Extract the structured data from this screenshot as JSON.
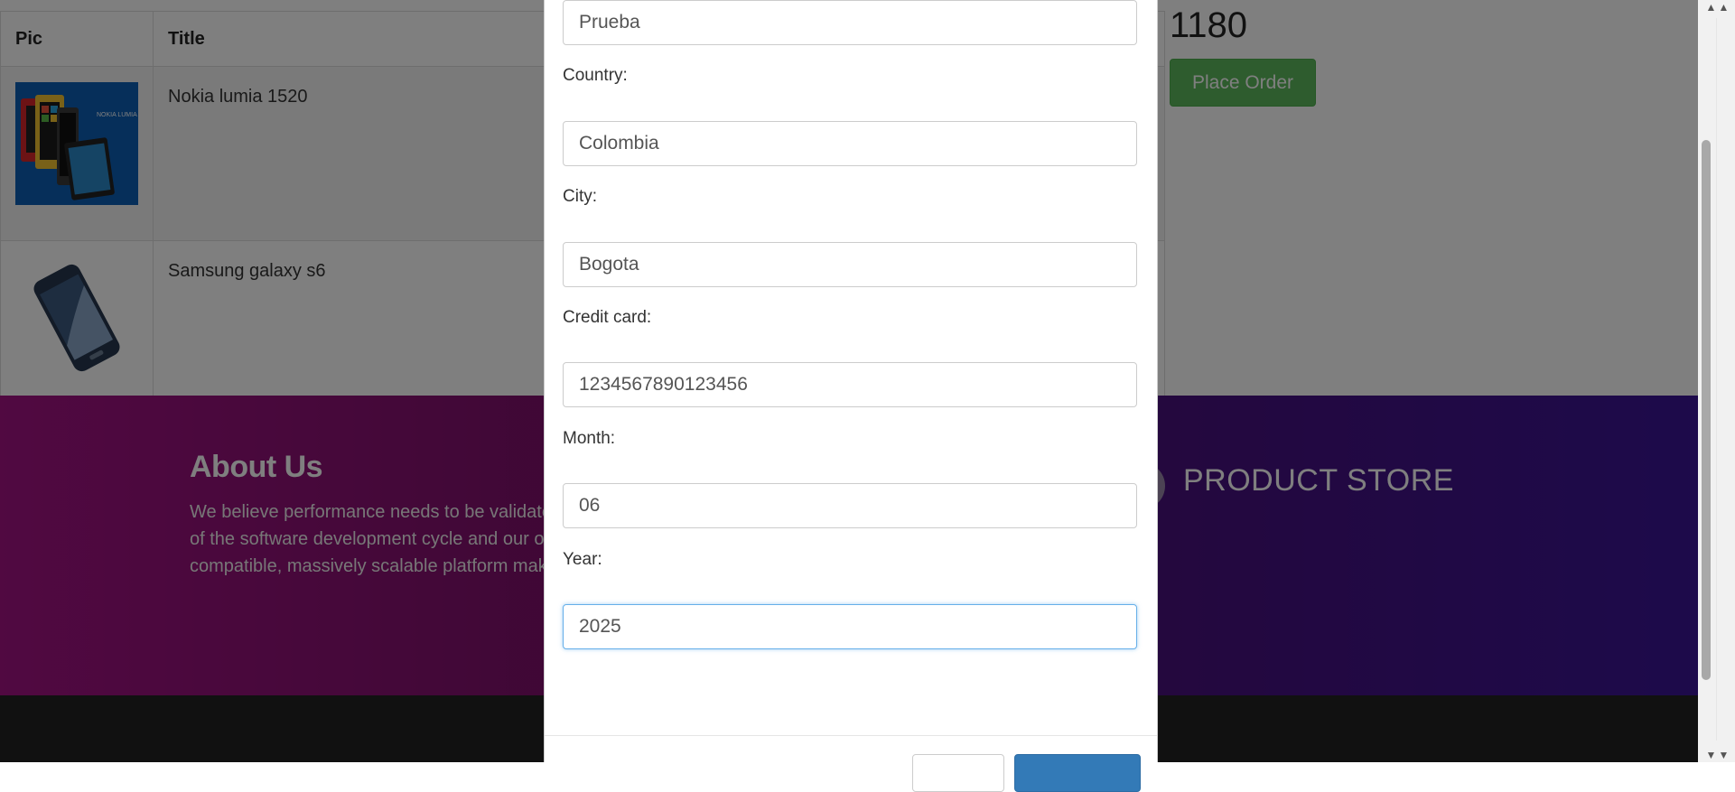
{
  "cart": {
    "headers": {
      "pic": "Pic",
      "title": "Title"
    },
    "rows": [
      {
        "title": "Nokia lumia 1520",
        "image_label": "NOKIA LUMIA"
      },
      {
        "title": "Samsung galaxy s6"
      }
    ],
    "total": "1180",
    "place_order_label": "Place Order"
  },
  "footer": {
    "about_title": "About Us",
    "about_lines": [
      "We believe performance needs to be validate",
      "of the software development cycle and our o",
      "compatible, massively scalable platform make"
    ],
    "store_title": "PRODUCT STORE"
  },
  "order_form": {
    "name_value": "Prueba",
    "country_label": "Country:",
    "country_value": "Colombia",
    "city_label": "City:",
    "city_value": "Bogota",
    "card_label": "Credit card:",
    "card_value": "1234567890123456",
    "month_label": "Month:",
    "month_value": "06",
    "year_label": "Year:",
    "year_value": "2025"
  },
  "colors": {
    "place_order": "#5cb85c",
    "primary": "#337ab7",
    "focus_border": "#66afe9"
  }
}
